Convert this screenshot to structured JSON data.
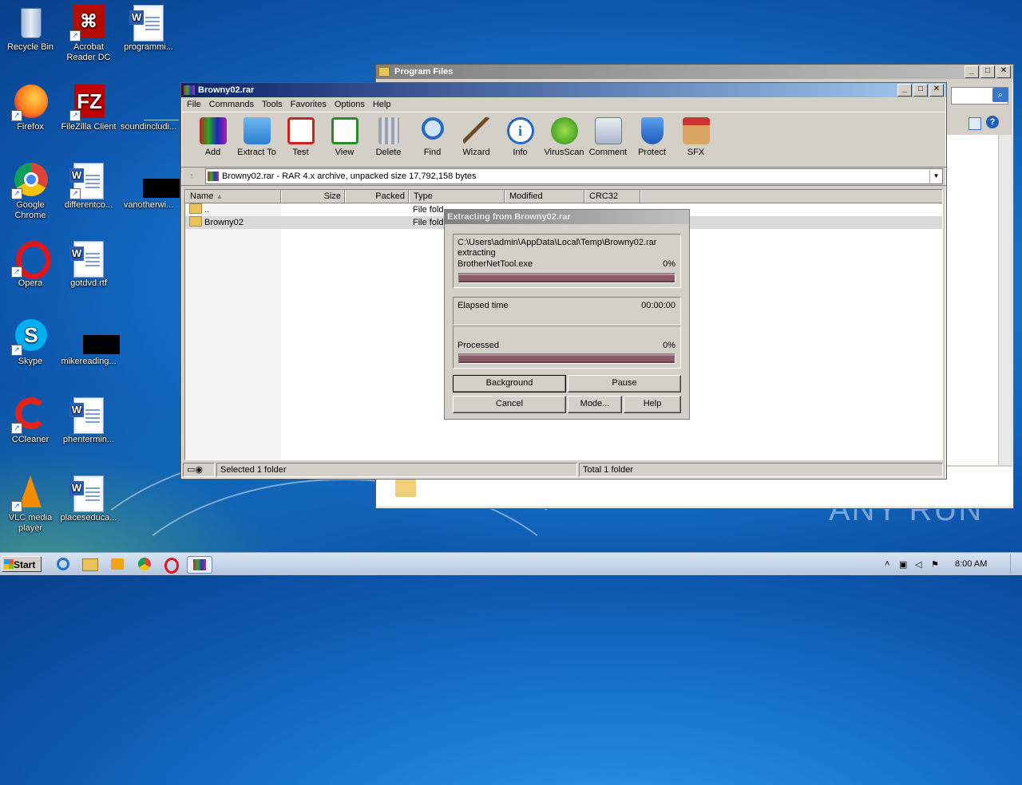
{
  "desktop": {
    "icons": [
      {
        "label": "Recycle Bin"
      },
      {
        "label": "Acrobat Reader DC"
      },
      {
        "label": "programmi..."
      },
      {
        "label": "Firefox"
      },
      {
        "label": "FileZilla Client"
      },
      {
        "label": "soundincludi..."
      },
      {
        "label": "Google Chrome"
      },
      {
        "label": "differentco..."
      },
      {
        "label": "vanotherwi..."
      },
      {
        "label": "Opera"
      },
      {
        "label": "gotdvd.rtf"
      },
      {
        "label": "Skype"
      },
      {
        "label": "mikereading..."
      },
      {
        "label": "CCleaner"
      },
      {
        "label": "phentermin..."
      },
      {
        "label": "VLC media player"
      },
      {
        "label": "placeseduca..."
      }
    ],
    "watermark": "ANY RUN"
  },
  "bg_window": {
    "title": "Program Files"
  },
  "winrar": {
    "title": "Browny02.rar",
    "menu": [
      "File",
      "Commands",
      "Tools",
      "Favorites",
      "Options",
      "Help"
    ],
    "tools": [
      {
        "label": "Add",
        "icon": "add-icon"
      },
      {
        "label": "Extract To",
        "icon": "extract-icon"
      },
      {
        "label": "Test",
        "icon": "test-icon"
      },
      {
        "label": "View",
        "icon": "view-icon"
      },
      {
        "label": "Delete",
        "icon": "delete-icon"
      },
      {
        "label": "Find",
        "icon": "find-icon"
      },
      {
        "label": "Wizard",
        "icon": "wizard-icon"
      },
      {
        "label": "Info",
        "icon": "info-icon"
      },
      {
        "label": "VirusScan",
        "icon": "virusscan-icon"
      },
      {
        "label": "Comment",
        "icon": "comment-icon"
      },
      {
        "label": "Protect",
        "icon": "protect-icon"
      },
      {
        "label": "SFX",
        "icon": "sfx-icon"
      }
    ],
    "address": "Browny02.rar - RAR 4.x archive, unpacked size 17,792,158 bytes",
    "columns": [
      "Name",
      "Size",
      "Packed",
      "Type",
      "Modified",
      "CRC32"
    ],
    "rows": [
      {
        "name": "..",
        "type": "File fold"
      },
      {
        "name": "Browny02",
        "type": "File fold"
      }
    ],
    "status_left": "Selected 1 folder",
    "status_right": "Total 1 folder"
  },
  "dialog": {
    "title": "Extracting from Browny02.rar",
    "path": "C:\\Users\\admin\\AppData\\Local\\Temp\\Browny02.rar",
    "action": "extracting",
    "file": "BrotherNetTool.exe",
    "file_percent": "0%",
    "file_progress": 0,
    "elapsed_label": "Elapsed time",
    "elapsed_value": "00:00:00",
    "processed_label": "Processed",
    "processed_percent": "0%",
    "processed_progress": 0,
    "buttons": {
      "background": "Background",
      "pause": "Pause",
      "cancel": "Cancel",
      "mode": "Mode...",
      "help": "Help"
    }
  },
  "taskbar": {
    "start": "Start",
    "time": "8:00 AM"
  }
}
